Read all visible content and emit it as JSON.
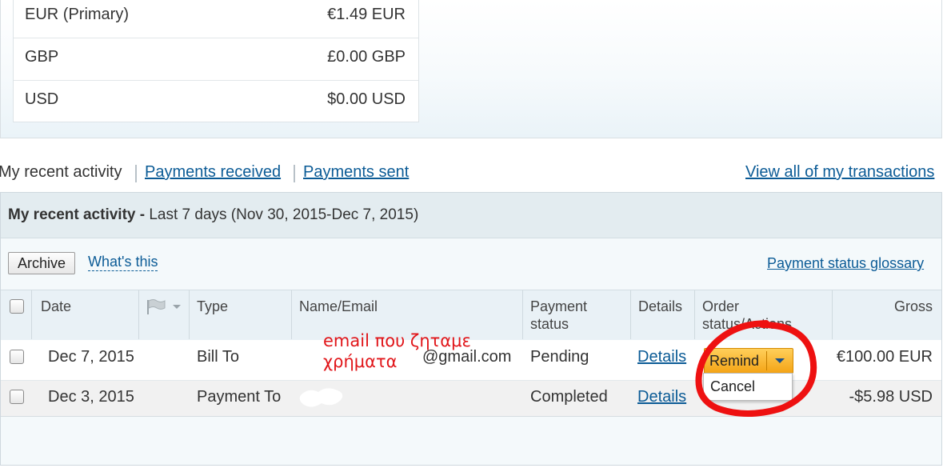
{
  "balances": [
    {
      "currency": "EUR (Primary)",
      "amount": "€1.49 EUR"
    },
    {
      "currency": "GBP",
      "amount": "£0.00 GBP"
    },
    {
      "currency": "USD",
      "amount": "$0.00 USD"
    }
  ],
  "activity_nav": {
    "current": "My recent activity",
    "payments_received": "Payments received",
    "payments_sent": "Payments sent",
    "view_all": "View all of my transactions"
  },
  "activity": {
    "title_bold": "My recent activity -",
    "title_range": " Last 7 days (Nov 30, 2015-Dec 7, 2015)",
    "archive_label": "Archive",
    "whats_this": "What's this",
    "glossary": "Payment status glossary"
  },
  "table": {
    "headers": {
      "date": "Date",
      "type": "Type",
      "name_email": "Name/Email",
      "payment_status_1": "Payment",
      "payment_status_2": "status",
      "details": "Details",
      "order_status_1": "Order",
      "order_status_2": "status/Actions",
      "gross": "Gross"
    },
    "rows": [
      {
        "date": "Dec 7, 2015",
        "type": "Bill To",
        "name_email": "@gmail.com",
        "status": "Pending",
        "details": "Details",
        "gross": "€100.00 EUR"
      },
      {
        "date": "Dec 3, 2015",
        "type": "Payment To",
        "name_email": "",
        "status": "Completed",
        "details": "Details",
        "gross": "-$5.98 USD"
      }
    ]
  },
  "order_action": {
    "button": "Remind",
    "menu_item": "Cancel"
  },
  "annotation": {
    "line1": "email που ζηταμε",
    "line2": "χρήματα",
    "color": "#e1161a"
  },
  "colors": {
    "link": "#0b5b96",
    "remind_button": "#f4a416"
  }
}
